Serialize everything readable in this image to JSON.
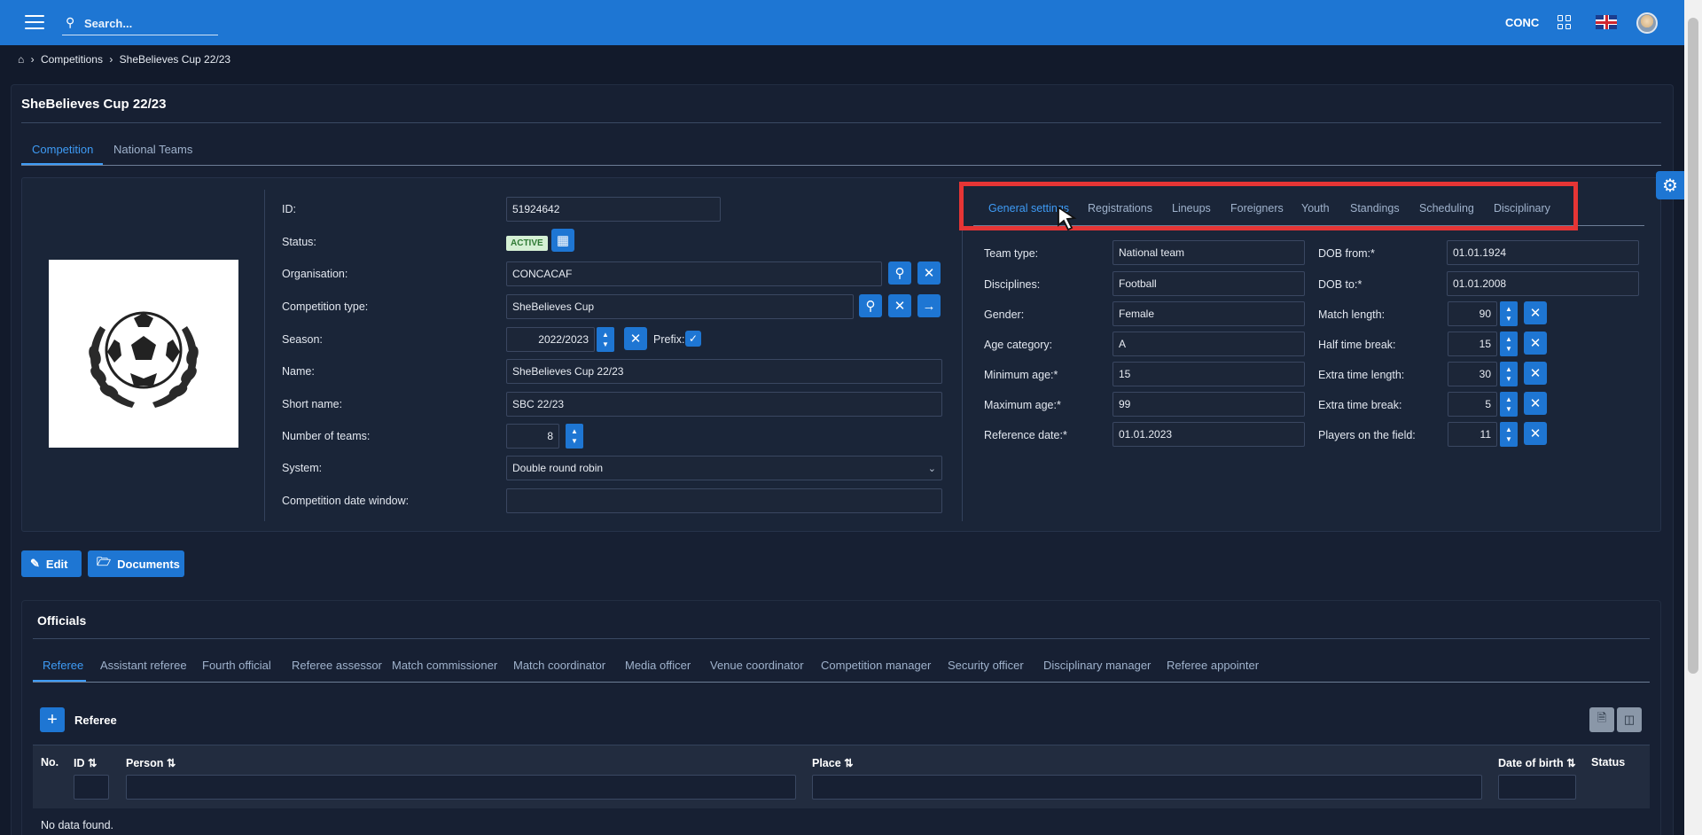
{
  "topbar": {
    "search_placeholder": "Search...",
    "user_code": "CONC",
    "icons": [
      "menu-icon",
      "search-icon",
      "apps-grid-icon",
      "uk-flag-icon",
      "avatar"
    ]
  },
  "breadcrumb": [
    "Competitions",
    "SheBelieves Cup 22/23"
  ],
  "page_title": "SheBelieves Cup 22/23",
  "main_tabs": [
    {
      "label": "Competition",
      "active": true
    },
    {
      "label": "National Teams",
      "active": false
    }
  ],
  "competition": {
    "labels": {
      "id": "ID:",
      "status": "Status:",
      "organisation": "Organisation:",
      "competition_type": "Competition type:",
      "season": "Season:",
      "prefix": "Prefix:",
      "name": "Name:",
      "short_name": "Short name:",
      "number_of_teams": "Number of teams:",
      "system": "System:",
      "date_window": "Competition date window:"
    },
    "values": {
      "id": "51924642",
      "status": "ACTIVE",
      "organisation": "CONCACAF",
      "competition_type": "SheBelieves Cup",
      "season": "2022/2023",
      "prefix_checked": true,
      "name": "SheBelieves Cup 22/23",
      "short_name": "SBC 22/23",
      "number_of_teams": "8",
      "system": "Double round robin",
      "date_window": ""
    }
  },
  "settings_tabs": [
    {
      "label": "General settings",
      "active": true
    },
    {
      "label": "Registrations",
      "active": false
    },
    {
      "label": "Lineups",
      "active": false
    },
    {
      "label": "Foreigners",
      "active": false
    },
    {
      "label": "Youth",
      "active": false
    },
    {
      "label": "Standings",
      "active": false
    },
    {
      "label": "Scheduling",
      "active": false
    },
    {
      "label": "Disciplinary",
      "active": false
    }
  ],
  "general_settings": {
    "left": [
      {
        "label": "Team type:",
        "value": "National team"
      },
      {
        "label": "Disciplines:",
        "value": "Football"
      },
      {
        "label": "Gender:",
        "value": "Female"
      },
      {
        "label": "Age category:",
        "value": "A"
      },
      {
        "label": "Minimum age:*",
        "value": "15"
      },
      {
        "label": "Maximum age:*",
        "value": "99"
      },
      {
        "label": "Reference date:*",
        "value": "01.01.2023"
      }
    ],
    "right": [
      {
        "label": "DOB from:*",
        "value": "01.01.1924"
      },
      {
        "label": "DOB to:*",
        "value": "01.01.2008"
      },
      {
        "label": "Match length:",
        "value": "90"
      },
      {
        "label": "Half time break:",
        "value": "15"
      },
      {
        "label": "Extra time length:",
        "value": "30"
      },
      {
        "label": "Extra time break:",
        "value": "5"
      },
      {
        "label": "Players on the field:",
        "value": "11"
      }
    ]
  },
  "actions": {
    "edit": "Edit",
    "documents": "Documents"
  },
  "officials": {
    "title": "Officials",
    "tabs": [
      {
        "label": "Referee",
        "active": true
      },
      {
        "label": "Assistant referee",
        "active": false
      },
      {
        "label": "Fourth official",
        "active": false
      },
      {
        "label": "Referee assessor",
        "active": false
      },
      {
        "label": "Match commissioner",
        "active": false
      },
      {
        "label": "Match coordinator",
        "active": false
      },
      {
        "label": "Media officer",
        "active": false
      },
      {
        "label": "Venue coordinator",
        "active": false
      },
      {
        "label": "Competition manager",
        "active": false
      },
      {
        "label": "Security officer",
        "active": false
      },
      {
        "label": "Disciplinary manager",
        "active": false
      },
      {
        "label": "Referee appointer",
        "active": false
      }
    ],
    "add_label": "Referee",
    "columns": {
      "no": "No.",
      "id": "ID",
      "person": "Person",
      "place": "Place",
      "dob": "Date of birth",
      "status": "Status"
    },
    "empty_text": "No data found."
  },
  "colors": {
    "accent": "#1e76d3",
    "highlight_box": "#e63535",
    "active_tab": "#3e9bf5"
  }
}
